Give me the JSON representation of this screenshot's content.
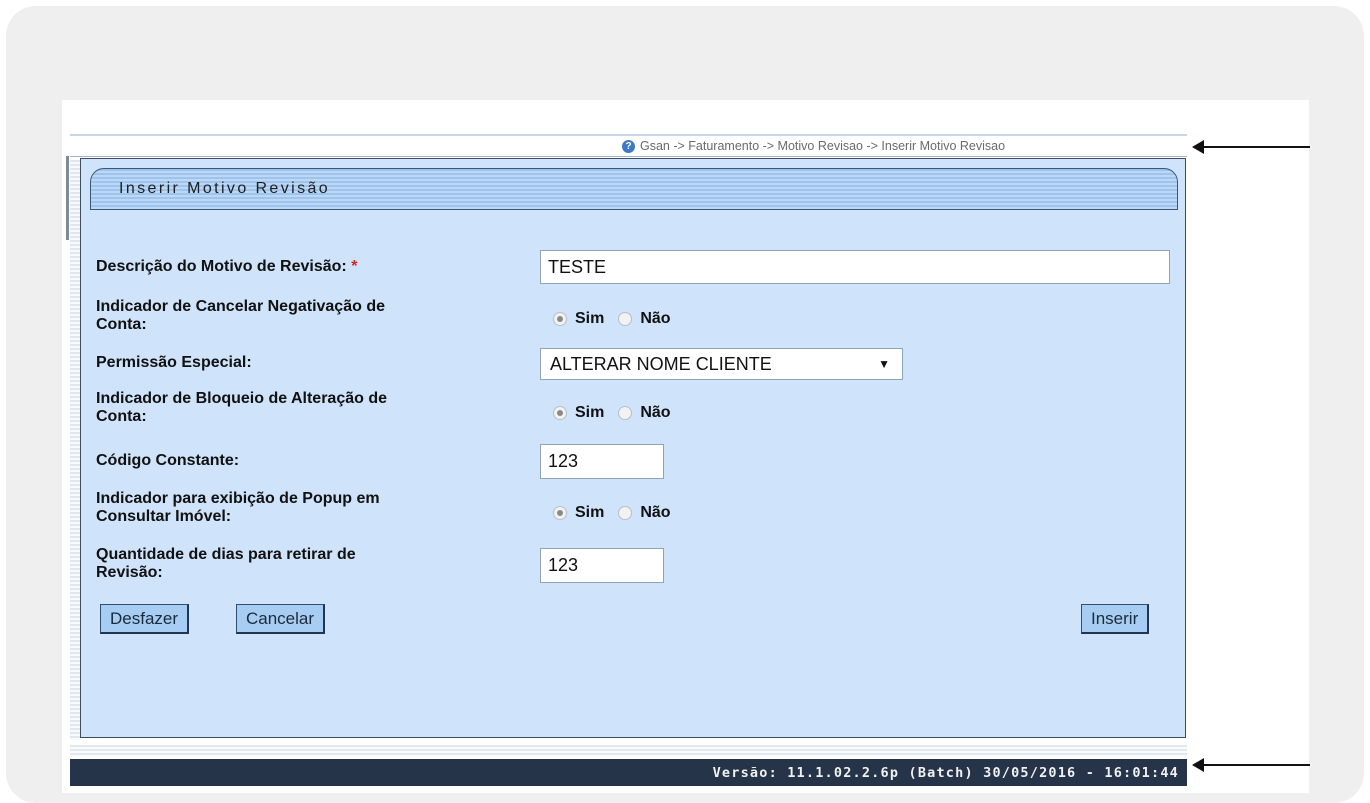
{
  "breadcrumb": "Gsan -> Faturamento -> Motivo Revisao -> Inserir Motivo Revisao",
  "form": {
    "title": "Inserir Motivo Revisão",
    "descricao_label": "Descrição do Motivo de Revisão:",
    "required_mark": "*",
    "descricao_value": "TESTE",
    "cancelar_neg_label_1": "Indicador de Cancelar Negativação de",
    "cancelar_neg_label_2": "Conta:",
    "permissao_label": "Permissão Especial:",
    "permissao_value": "ALTERAR NOME CLIENTE",
    "bloqueio_label_1": "Indicador de Bloqueio de Alteração de",
    "bloqueio_label_2": "Conta:",
    "codigo_label": "Código Constante:",
    "codigo_value": "123",
    "popup_label_1": "Indicador para exibição de Popup em",
    "popup_label_2": "Consultar Imóvel:",
    "dias_label_1": "Quantidade de dias para retirar de",
    "dias_label_2": "Revisão:",
    "dias_value": "123",
    "sim": "Sim",
    "nao": "Não"
  },
  "buttons": {
    "desfazer": "Desfazer",
    "cancelar": "Cancelar",
    "inserir": "Inserir"
  },
  "footer": "Versão: 11.1.02.2.6p (Batch) 30/05/2016 - 16:01:44"
}
